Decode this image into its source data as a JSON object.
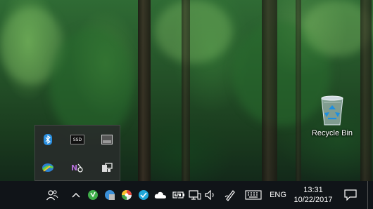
{
  "desktop": {
    "recycle_bin_label": "Recycle Bin"
  },
  "tray_overflow": {
    "icons": [
      "bluetooth-icon",
      "ssd-icon",
      "window-icon",
      "internet-download-manager-icon",
      "onenote-clipper-icon",
      "devices-icon"
    ],
    "ssd_label": "SSD"
  },
  "taskbar": {
    "people_icon": "people-icon",
    "show_hidden_icon": "chevron-up-icon",
    "tray_icons": [
      "sync-icon",
      "disk-icon",
      "chrome-ext-icon",
      "check-cloud-icon",
      "onedrive-icon",
      "battery-icon",
      "network-icon",
      "volume-icon",
      "pen-icon",
      "keyboard-icon"
    ],
    "language": "ENG",
    "time": "13:31",
    "date": "10/22/2017",
    "action_center_icon": "notification-icon"
  },
  "colors": {
    "taskbar_bg": "#101418",
    "panel_bg": "#2c302e",
    "accent_blue": "#2a8fe0",
    "accent_green": "#3fae49"
  }
}
